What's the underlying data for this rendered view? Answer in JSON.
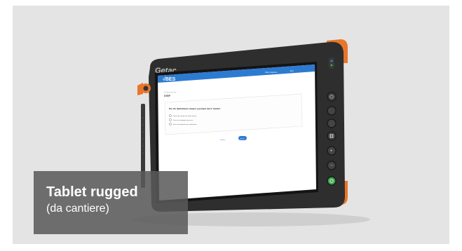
{
  "photo": {
    "background_color": "#e4e4e4",
    "device_brand": "Getac",
    "screen": {
      "app_logo": "√BES",
      "header_user": "Nome Cognome",
      "header_exit": "Esci",
      "breadcrumb": "Lorem ipsum step",
      "step_label": "STEP",
      "question": "Per chi dedichiamo sempre a perdere dal 1° livello?",
      "options": [
        "Sono alla sempre da andar pronto",
        "Sono una maggiore percorso",
        "Sono normalmente per produzione"
      ],
      "back_link": "Indietro",
      "next_button": "Avanti",
      "accent_color": "#2d7bd0"
    },
    "side_buttons": [
      "power-icon",
      "home-icon",
      "back-icon",
      "grid-icon",
      "plus-icon",
      "minus-icon",
      "check-icon"
    ]
  },
  "caption": {
    "title": "Tablet rugged",
    "subtitle": "(da cantiere)"
  }
}
